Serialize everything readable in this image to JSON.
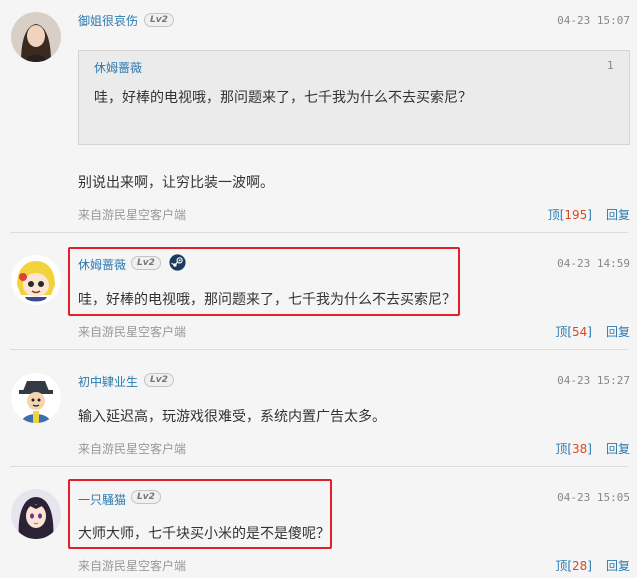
{
  "comments": [
    {
      "username": "御姐很哀伤",
      "level": "Lv2",
      "timestamp": "04-23 15:07",
      "quote": {
        "username": "休姆蔷薇",
        "floor": "1",
        "text": "哇，好棒的电视哦，那问题来了，七千我为什么不去买索尼？"
      },
      "content": "别说出来啊，让穷比装一波啊。",
      "source": "来自游民星空客户端",
      "upvote_label": "顶",
      "upvote_count": "195",
      "reply_label": "回复"
    },
    {
      "username": "休姆蔷薇",
      "level": "Lv2",
      "platform_icon": "steam-icon",
      "timestamp": "04-23 14:59",
      "content": "哇，好棒的电视哦，那问题来了，七千我为什么不去买索尼？",
      "source": "来自游民星空客户端",
      "upvote_label": "顶",
      "upvote_count": "54",
      "reply_label": "回复"
    },
    {
      "username": "初中肄业生",
      "level": "Lv2",
      "timestamp": "04-23 15:27",
      "content": "输入延迟高，玩游戏很难受，系统内置广告太多。",
      "source": "来自游民星空客户端",
      "upvote_label": "顶",
      "upvote_count": "38",
      "reply_label": "回复"
    },
    {
      "username": "一只騒猫",
      "level": "Lv2",
      "timestamp": "04-23 15:05",
      "content": "大师大师，七千块买小米的是不是傻呢？",
      "source": "来自游民星空客户端",
      "upvote_label": "顶",
      "upvote_count": "28",
      "reply_label": "回复"
    }
  ],
  "colors": {
    "link": "#2a7ab0",
    "count": "#d9481f",
    "highlight": "#e0202a",
    "background": "#f5f5f5"
  }
}
